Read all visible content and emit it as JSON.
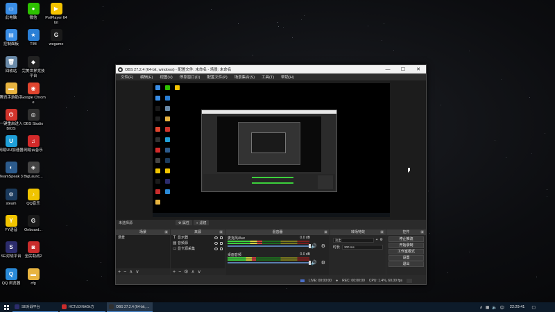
{
  "desktop": {
    "icons": [
      {
        "label": "此电脑",
        "icon": "computer-icon",
        "color": "#3a8ee6",
        "glyph": "▭"
      },
      {
        "label": "微信",
        "icon": "wechat-icon",
        "color": "#2dc100",
        "glyph": "●"
      },
      {
        "label": "PotPlayer 64 bit",
        "icon": "potplayer-icon",
        "color": "#f5c400",
        "glyph": "▶"
      },
      {
        "label": "控制面板",
        "icon": "control-panel-icon",
        "color": "#3a8ee6",
        "glyph": "▤"
      },
      {
        "label": "TIM",
        "icon": "tim-icon",
        "color": "#2a7fd6",
        "glyph": "★"
      },
      {
        "label": "wegame",
        "icon": "wegame-icon",
        "color": "#1a1a1a",
        "glyph": "G"
      },
      {
        "label": "回收站",
        "icon": "recycle-bin-icon",
        "color": "#6a8aa8",
        "glyph": "🗑"
      },
      {
        "label": "完美世界竞技平台",
        "icon": "perfect-world-icon",
        "color": "#222222",
        "glyph": "◆"
      },
      {
        "label": "腾讯手游助手",
        "icon": "folder-icon",
        "color": "#e8b440",
        "glyph": "▬"
      },
      {
        "label": "Google Chrome",
        "icon": "chrome-icon",
        "color": "#e0452f",
        "glyph": "◉"
      },
      {
        "label": "一键重启进入 BIOS",
        "icon": "bios-icon",
        "color": "#d0342c",
        "glyph": "⏻"
      },
      {
        "label": "OBS Studio",
        "icon": "obs-icon",
        "color": "#303030",
        "glyph": "◎"
      },
      {
        "label": "网易UU加速器",
        "icon": "uu-accelerator-icon",
        "color": "#1f9fd8",
        "glyph": "U"
      },
      {
        "label": "网易云音乐",
        "icon": "netease-music-icon",
        "color": "#d42a2a",
        "glyph": "♫"
      },
      {
        "label": "TeamSpeak 3",
        "icon": "teamspeak-icon",
        "color": "#2c5b8c",
        "glyph": "◐"
      },
      {
        "label": "BigLaunc...",
        "icon": "biglauncher-icon",
        "color": "#444444",
        "glyph": "◈"
      },
      {
        "label": "steam",
        "icon": "steam-icon",
        "color": "#1b3a5c",
        "glyph": "⚙"
      },
      {
        "label": "QQ音乐",
        "icon": "qq-music-icon",
        "color": "#f0c400",
        "glyph": "♪"
      },
      {
        "label": "YY语音",
        "icon": "yy-icon",
        "color": "#f2c500",
        "glyph": "Y"
      },
      {
        "label": "Onboard...",
        "icon": "onboard-icon",
        "color": "#1a1a1a",
        "glyph": "G"
      },
      {
        "label": "SE对战平台",
        "icon": "se-platform-icon",
        "color": "#2c2c6c",
        "glyph": "S"
      },
      {
        "label": "全民助战2",
        "icon": "game-helper-icon",
        "color": "#c82c2c",
        "glyph": "◙"
      },
      {
        "label": "QQ 浏览器",
        "icon": "qq-browser-icon",
        "color": "#2a8ad8",
        "glyph": "Q"
      },
      {
        "label": "cfg",
        "icon": "cfg-folder-icon",
        "color": "#e8b440",
        "glyph": "▬"
      }
    ]
  },
  "obs": {
    "title": "OBS 27.2.4 (64-bit, windows) - 配置文件: 未命名 - 场景: 未命名",
    "menu": [
      "文件(F)",
      "编辑(E)",
      "视图(V)",
      "停靠窗口(D)",
      "配置文件(P)",
      "场景集合(S)",
      "工具(T)",
      "帮助(H)"
    ],
    "scene_label": "未选择源",
    "preview_tabs": [
      "属性",
      "滤镜"
    ],
    "docks": {
      "scenes": {
        "title": "场景",
        "items": [
          "场景"
        ]
      },
      "sources": {
        "title": "来源",
        "items": [
          "显示器",
          "音频源",
          "显卡源采集"
        ]
      },
      "mixer": {
        "title": "混音器",
        "tracks": [
          {
            "name": "麦克风/Aux",
            "db": "0.0 dB",
            "level": 0.42
          },
          {
            "name": "桌面音频",
            "db": "0.0 dB",
            "level": 0.35
          }
        ]
      },
      "transitions": {
        "title": "转场特效",
        "type": "淡出",
        "duration_label": "时长",
        "duration": "300 ms"
      },
      "controls": {
        "title": "控件",
        "buttons": [
          "停止推流",
          "开始录制",
          "工作室模式",
          "设置",
          "退出"
        ]
      }
    },
    "status": {
      "live": "LIVE: 00:00:00",
      "rec": "REC: 00:00:00",
      "cpu": "CPU: 1.4%, 60.00 fps"
    }
  },
  "taskbar": {
    "items": [
      {
        "label": "SE对战平台",
        "color": "#2c2c6c",
        "active": false
      },
      {
        "label": "HCTc5XNAGk方",
        "color": "#c82c2c",
        "active": false
      },
      {
        "label": "OBS 27.2.4 (64-bit, ...",
        "color": "#303030",
        "active": true
      }
    ],
    "clock": "22:29:41",
    "tray_icons": [
      "chevron-up-icon",
      "network-icon",
      "volume-icon",
      "ime-icon",
      "notification-icon"
    ]
  }
}
